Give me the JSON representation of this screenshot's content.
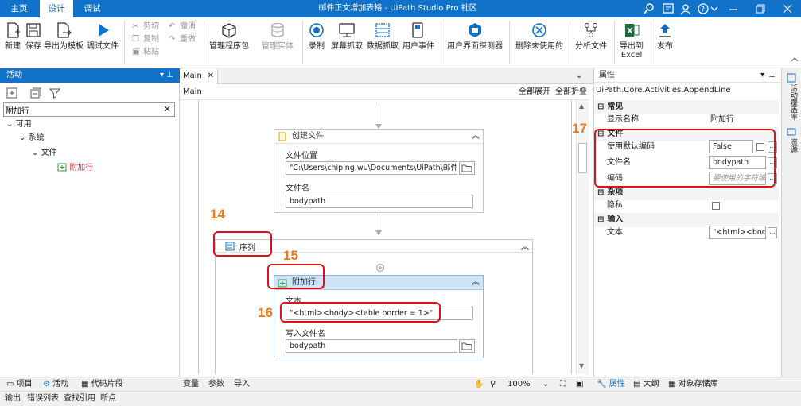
{
  "menu": {
    "tabs": [
      "主页",
      "设计",
      "调试"
    ],
    "active": 1
  },
  "window": {
    "title": "邮件正文增加表格 - UiPath Studio Pro 社区"
  },
  "ribbon": {
    "new": "新建",
    "save": "保存",
    "export_template": "导出为模板",
    "debug_file": "调试文件",
    "cut": "剪切",
    "copy": "复制",
    "paste": "粘贴",
    "undo": "撤消",
    "redo": "重做",
    "manage_packages": "管理程序包",
    "manage_entities": "管理实体",
    "record": "录制",
    "screen_scraping": "屏幕抓取",
    "data_scraping": "数据抓取",
    "user_events": "用户事件",
    "ui_explorer": "用户界面探测器",
    "remove_unused": "删除未使用的",
    "analyze_file": "分析文件",
    "export_excel_1": "导出到",
    "export_excel_2": "Excel",
    "publish": "发布"
  },
  "activities": {
    "header": "活动",
    "search_value": "附加行",
    "tree": {
      "available": "可用",
      "system": "系统",
      "file": "文件",
      "append_line": "附加行"
    }
  },
  "designer": {
    "tab": "Main",
    "breadcrumb": "Main",
    "expand_all": "全部展开",
    "collapse_all": "全部折叠",
    "create_file": {
      "title": "创建文件",
      "location_label": "文件位置",
      "location_value": "\"C:\\Users\\chiping.wu\\Documents\\UiPath\\邮件...",
      "name_label": "文件名",
      "name_value": "bodypath"
    },
    "sequence": {
      "title": "序列"
    },
    "append_line": {
      "title": "附加行",
      "text_label": "文本",
      "text_value": "\"<html><body><table border = 1>\"",
      "write_label": "写入文件名",
      "write_value": "bodypath"
    },
    "bottom": {
      "variables": "变量",
      "arguments": "参数",
      "imports": "导入",
      "zoom": "100%"
    }
  },
  "callouts": {
    "c14": "14",
    "c15": "15",
    "c16": "16",
    "c17": "17"
  },
  "properties": {
    "header": "属性",
    "type": "UiPath.Core.Activities.AppendLine",
    "sec_common": "常见",
    "display_name_label": "显示名称",
    "display_name_value": "附加行",
    "sec_file": "文件",
    "use_default_encoding_label": "使用默认编码",
    "use_default_encoding_value": "False",
    "filename_label": "文件名",
    "filename_value": "bodypath",
    "encoding_label": "编码",
    "encoding_placeholder": "要使用的字符编",
    "sec_misc": "杂项",
    "private_label": "隐私",
    "sec_input": "输入",
    "text_label": "文本",
    "text_value": "\"<html><bod"
  },
  "right_strip": {
    "activity_coverage": "活动覆盖率",
    "resources": "资源"
  },
  "bottom_tabs": {
    "project": "项目",
    "activities": "活动",
    "snippets": "代码片段",
    "properties": "属性",
    "outline": "大纲",
    "object_repo": "对象存储库"
  },
  "status_tabs": {
    "output": "输出",
    "error_list": "错误列表",
    "find_refs": "查找引用",
    "breakpoints": "断点"
  },
  "colors": {
    "accent": "#1172c9",
    "callout": "#f07a1a",
    "highlight": "#e0101a"
  }
}
